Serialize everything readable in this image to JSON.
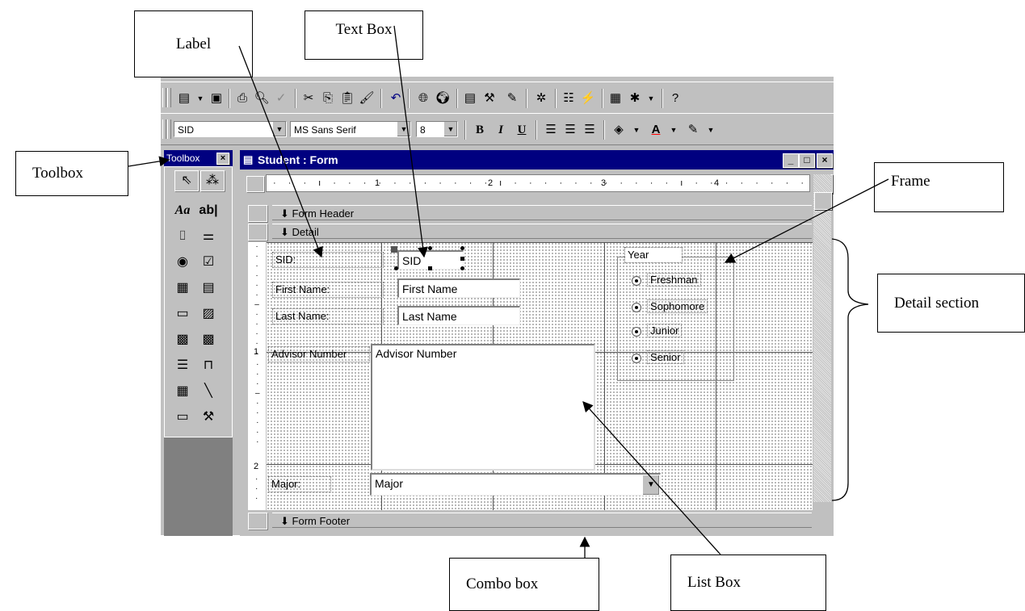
{
  "callouts": {
    "label": "Label",
    "text_box": "Text Box",
    "toolbox": "Toolbox",
    "frame": "Frame",
    "detail_section": "Detail section",
    "combo_box": "Combo box",
    "list_box": "List Box"
  },
  "toolbar_format": {
    "object_combo": "SID",
    "font_combo": "MS Sans Serif",
    "size_combo": "8",
    "bold": "B",
    "italic": "I",
    "underline": "U"
  },
  "toolbox": {
    "title": "Toolbox",
    "close": "×",
    "label_tool": "Aa",
    "textbox_tool": "ab|"
  },
  "form_window": {
    "title": "Student : Form",
    "min": "_",
    "max": "□",
    "close": "×",
    "ruler_marks": [
      "1",
      "2",
      "3",
      "4"
    ],
    "vruler_marks": [
      "1",
      "2"
    ]
  },
  "sections": {
    "form_header": "Form Header",
    "detail": "Detail",
    "form_footer": "Form Footer"
  },
  "fields": {
    "sid_label": "SID:",
    "sid_box": "SID",
    "first_name_label": "First Name:",
    "first_name_box": "First Name",
    "last_name_label": "Last Name:",
    "last_name_box": "Last Name",
    "advisor_label": "Advisor Number",
    "advisor_list": "Advisor Number",
    "major_label": "Major:",
    "major_combo": "Major"
  },
  "frame": {
    "label": "Year",
    "options": [
      "Freshman",
      "Sophomore",
      "Junior",
      "Senior"
    ]
  }
}
